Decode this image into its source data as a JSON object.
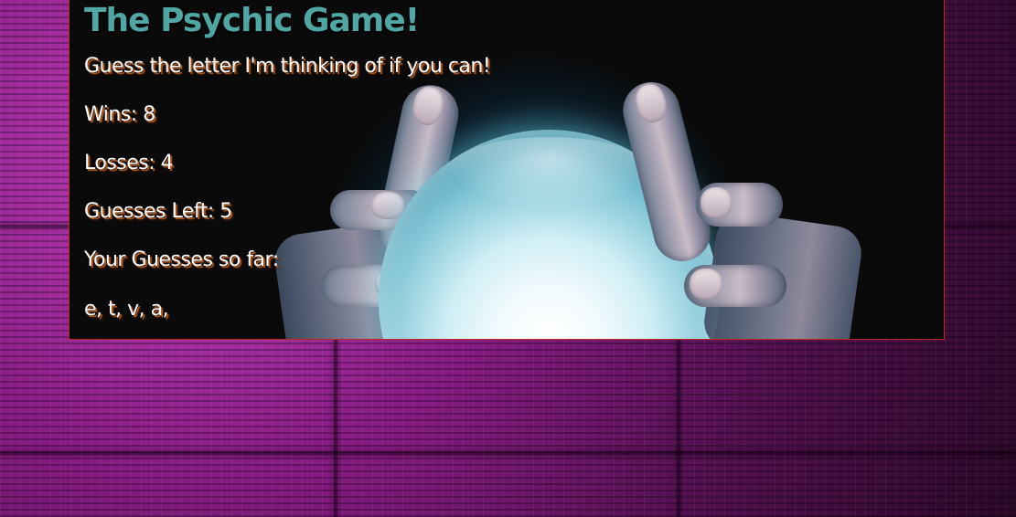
{
  "game": {
    "title": "The Psychic Game!",
    "instructions": "Guess the letter I'm thinking of if you can!",
    "wins_text": "Wins: 8",
    "losses_text": "Losses: 4",
    "guesses_left_text": "Guesses Left: 5",
    "guesses_so_far_label": "Your Guesses so far:",
    "guesses_so_far_value": "e, t, v, a,"
  },
  "colors": {
    "background_accent": "#8a1c86",
    "panel_background": "#0a0a0a",
    "panel_border": "#c0281c",
    "title_color": "#4fa6a3",
    "text_color": "#ffffff",
    "text_shadow": "#a0521c",
    "ball_glow": "#46bedc"
  }
}
